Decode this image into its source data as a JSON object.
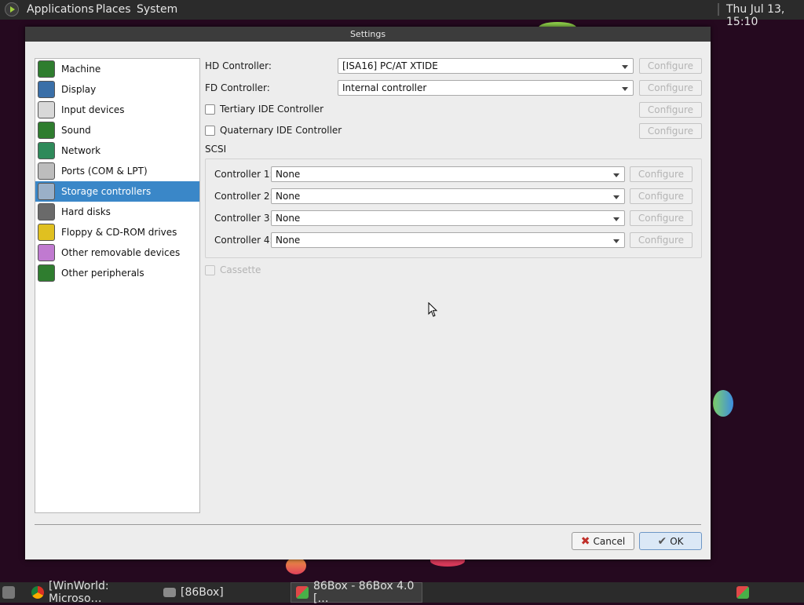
{
  "top_panel": {
    "menus": [
      "Applications",
      "Places",
      "System"
    ],
    "clock": "Thu Jul 13, 15:10"
  },
  "window": {
    "title": "Settings",
    "nav": [
      {
        "label": "Machine",
        "icon": "motherboard-icon"
      },
      {
        "label": "Display",
        "icon": "display-card-icon"
      },
      {
        "label": "Input devices",
        "icon": "keyboard-mouse-icon"
      },
      {
        "label": "Sound",
        "icon": "sound-card-icon"
      },
      {
        "label": "Network",
        "icon": "network-icon"
      },
      {
        "label": "Ports (COM & LPT)",
        "icon": "ports-icon"
      },
      {
        "label": "Storage controllers",
        "icon": "storage-icon"
      },
      {
        "label": "Hard disks",
        "icon": "hard-disk-icon"
      },
      {
        "label": "Floppy & CD-ROM drives",
        "icon": "floppy-cdrom-icon"
      },
      {
        "label": "Other removable devices",
        "icon": "removable-device-icon"
      },
      {
        "label": "Other peripherals",
        "icon": "peripheral-chip-icon"
      }
    ],
    "selected_nav": "Storage controllers",
    "storage": {
      "hd_label": "HD Controller:",
      "hd_value": "[ISA16] PC/AT XTIDE",
      "fd_label": "FD Controller:",
      "fd_value": "Internal controller",
      "tertiary_label": "Tertiary IDE Controller",
      "quaternary_label": "Quaternary IDE Controller",
      "configure_label": "Configure",
      "scsi_label": "SCSI",
      "scsi_controllers": [
        {
          "label": "Controller 1:",
          "value": "None"
        },
        {
          "label": "Controller 2:",
          "value": "None"
        },
        {
          "label": "Controller 3:",
          "value": "None"
        },
        {
          "label": "Controller 4:",
          "value": "None"
        }
      ],
      "cassette_label": "Cassette"
    },
    "cancel_label": "Cancel",
    "ok_label": "OK"
  },
  "taskbar": {
    "tasks": [
      "[WinWorld: Microso…",
      "[86Box]",
      "86Box - 86Box 4.0 […"
    ]
  },
  "colors": {
    "desktop": "#25091f",
    "selection": "#3a87c8",
    "panel": "#2b2b2b"
  }
}
